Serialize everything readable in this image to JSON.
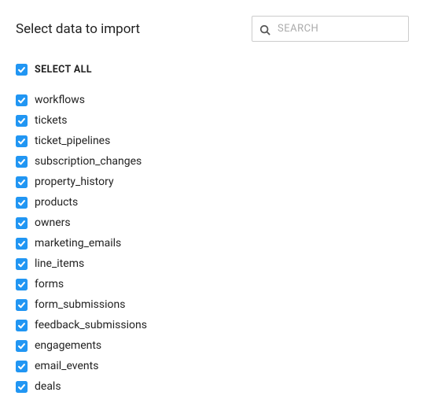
{
  "header": {
    "title": "Select data to import",
    "search_placeholder": "SEARCH"
  },
  "select_all": {
    "label": "SELECT ALL",
    "checked": true
  },
  "items": [
    {
      "label": "workflows",
      "checked": true
    },
    {
      "label": "tickets",
      "checked": true
    },
    {
      "label": "ticket_pipelines",
      "checked": true
    },
    {
      "label": "subscription_changes",
      "checked": true
    },
    {
      "label": "property_history",
      "checked": true
    },
    {
      "label": "products",
      "checked": true
    },
    {
      "label": "owners",
      "checked": true
    },
    {
      "label": "marketing_emails",
      "checked": true
    },
    {
      "label": "line_items",
      "checked": true
    },
    {
      "label": "forms",
      "checked": true
    },
    {
      "label": "form_submissions",
      "checked": true
    },
    {
      "label": "feedback_submissions",
      "checked": true
    },
    {
      "label": "engagements",
      "checked": true
    },
    {
      "label": "email_events",
      "checked": true
    },
    {
      "label": "deals",
      "checked": true
    }
  ]
}
